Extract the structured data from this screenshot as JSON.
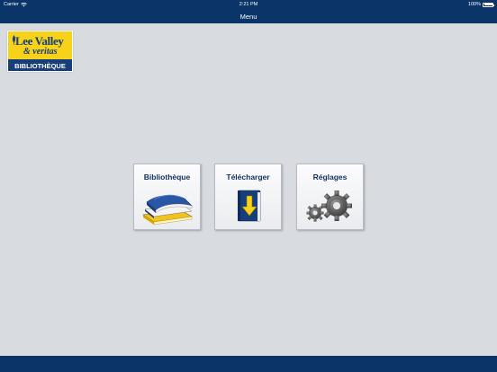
{
  "status_bar": {
    "carrier": "Carrier",
    "time": "2:21 PM",
    "battery": "100%",
    "battery_level": 1.0
  },
  "nav_bar": {
    "title": "Menu"
  },
  "logo": {
    "line1": "Lee Valley",
    "line2": "& veritas",
    "band": "BIBLIOTHÈQUE"
  },
  "tiles": [
    {
      "id": "library",
      "label": "Bibliothèque",
      "icon": "books-icon"
    },
    {
      "id": "download",
      "label": "Télécharger",
      "icon": "download-book-icon"
    },
    {
      "id": "settings",
      "label": "Réglages",
      "icon": "gears-icon"
    }
  ],
  "colors": {
    "brand_navy": "#0b3468",
    "logo_yellow": "#f6d21a",
    "logo_blue": "#173d7a",
    "background": "#d8dbe0"
  }
}
